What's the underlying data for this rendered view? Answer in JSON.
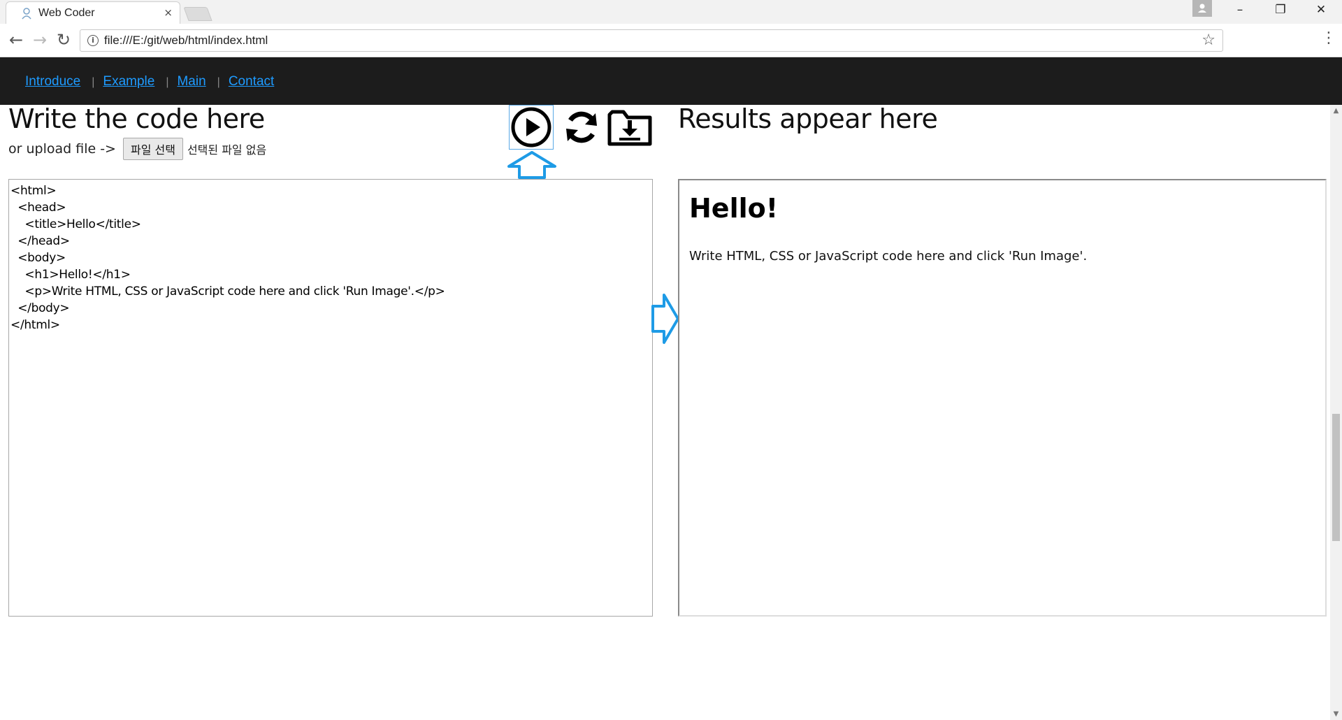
{
  "browser": {
    "tab_title": "Web Coder",
    "tab_close": "×",
    "url": "file:///E:/git/web/html/index.html",
    "window_controls": {
      "minimize": "–",
      "restore": "❐",
      "close": "✕"
    }
  },
  "nav": {
    "links": [
      "Introduce",
      "Example",
      "Main",
      "Contact"
    ],
    "separator": "|"
  },
  "editor": {
    "heading": "Write the code here",
    "upload_prefix": "or upload file ->",
    "file_button": "파일 선택",
    "file_status": "선택된 파일 없음",
    "code_lines": [
      "<html>",
      "  <head>",
      "    <title>Hello</title>",
      "  </head>",
      "  <body>",
      "    <h1>Hello!</h1>",
      "    <p>Write HTML, CSS or JavaScript code here and click 'Run Image'.</p>",
      "  </body>",
      "</html>"
    ]
  },
  "result": {
    "heading": "Results appear here",
    "h1": "Hello!",
    "p": "Write HTML, CSS or JavaScript code here and click 'Run Image'."
  },
  "colors": {
    "nav_bg": "#1c1c1c",
    "link": "#1e9bff",
    "arrow_accent": "#1e9be6"
  },
  "icons": {
    "run": "play-icon",
    "reload": "reload-icon",
    "save": "download-folder-icon"
  }
}
